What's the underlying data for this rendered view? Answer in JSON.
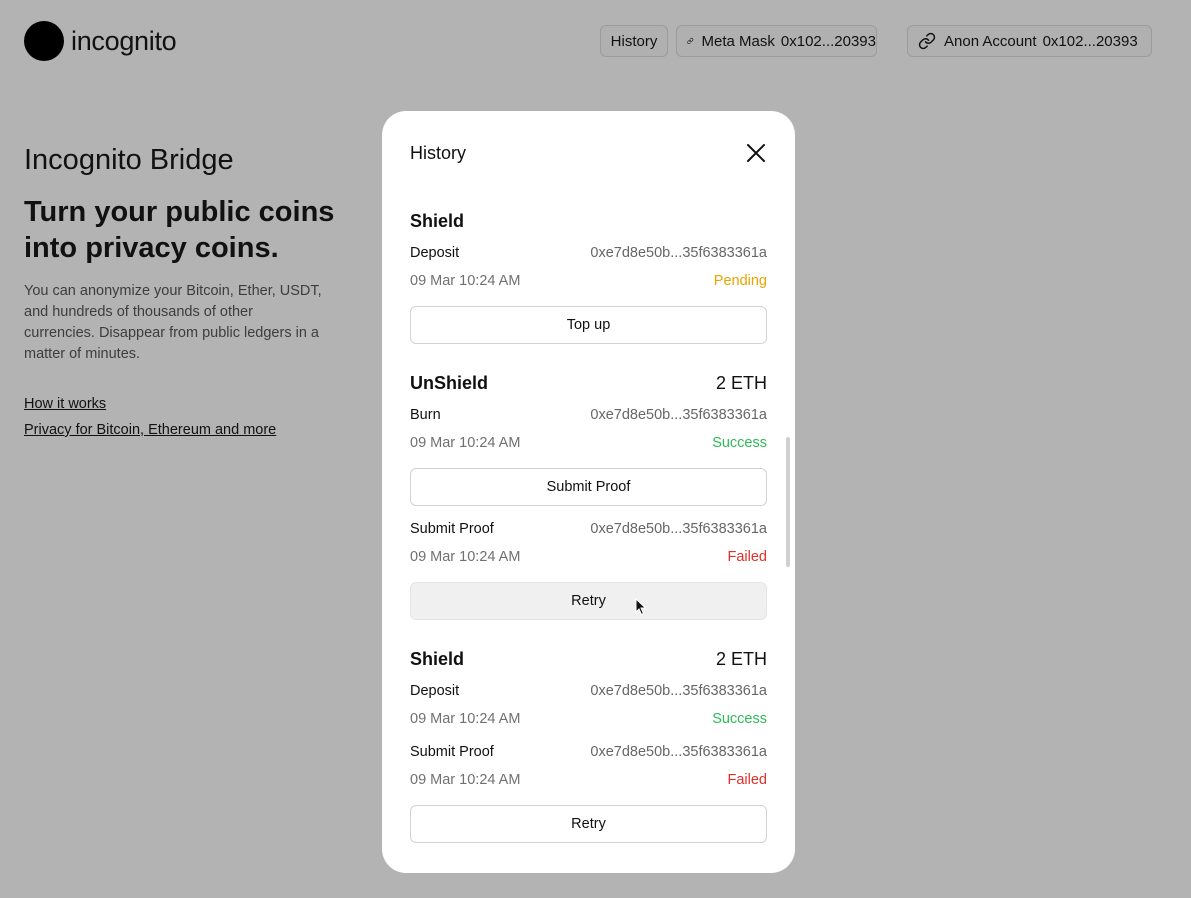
{
  "header": {
    "logo_text": "incognito",
    "history_label": "History",
    "metamask_label": "Meta Mask",
    "metamask_address": "0x102...20393",
    "anon_label": "Anon Account",
    "anon_address": "0x102...20393"
  },
  "hero": {
    "subtitle": "Incognito Bridge",
    "title": "Turn your public coins into privacy coins.",
    "description": "You can anonymize your Bitcoin, Ether, USDT, and hundreds of thousands of other currencies. Disappear from public ledgers in a matter of minutes.",
    "links": [
      "How it works",
      "Privacy for Bitcoin, Ethereum and more"
    ]
  },
  "modal": {
    "title": "History",
    "sections": [
      {
        "title": "Shield",
        "amount": "",
        "entries": [
          {
            "label": "Deposit",
            "hash": "0xe7d8e50b...35f6383361a",
            "date": "09 Mar 10:24 AM",
            "status": "Pending"
          }
        ],
        "button": "Top up"
      },
      {
        "title": "UnShield",
        "amount": "2 ETH",
        "entries": [
          {
            "label": "Burn",
            "hash": "0xe7d8e50b...35f6383361a",
            "date": "09 Mar 10:24 AM",
            "status": "Success"
          },
          {
            "label": "Submit Proof",
            "hash": "0xe7d8e50b...35f6383361a",
            "date": "09 Mar 10:24 AM",
            "status": "Failed"
          }
        ],
        "buttons": [
          "Submit Proof",
          "Retry"
        ]
      },
      {
        "title": "Shield",
        "amount": "2 ETH",
        "entries": [
          {
            "label": "Deposit",
            "hash": "0xe7d8e50b...35f6383361a",
            "date": "09 Mar 10:24 AM",
            "status": "Success"
          },
          {
            "label": "Submit Proof",
            "hash": "0xe7d8e50b...35f6383361a",
            "date": "09 Mar 10:24 AM",
            "status": "Failed"
          }
        ],
        "button": "Retry"
      }
    ]
  },
  "colors": {
    "pending": "#e8a500",
    "success": "#2dbb57",
    "failed": "#e0302a",
    "backdrop": "#b3b3b3"
  },
  "icons": [
    "link-icon",
    "close-icon",
    "mouse-cursor-icon"
  ]
}
